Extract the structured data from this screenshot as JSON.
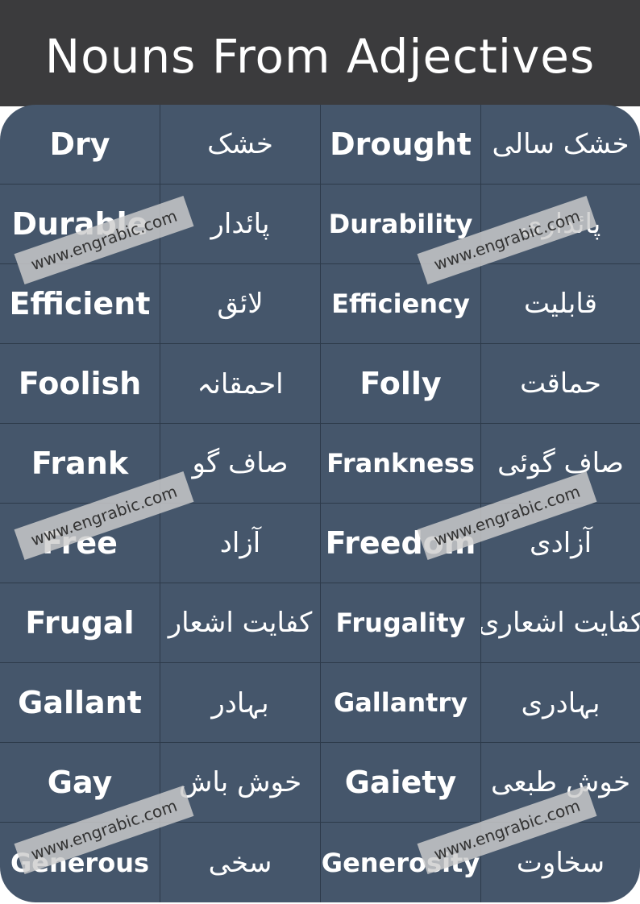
{
  "title": "Nouns From Adjectives",
  "rows": [
    {
      "adj": "Dry",
      "adj_ur": "خشک",
      "noun": "Drought",
      "noun_ur": "خشک سالی"
    },
    {
      "adj": "Durable",
      "adj_ur": "پائدار",
      "noun": "Durability",
      "noun_ur": "پائداری"
    },
    {
      "adj": "Efficient",
      "adj_ur": "لائق",
      "noun": "Efficiency",
      "noun_ur": "قابلیت"
    },
    {
      "adj": "Foolish",
      "adj_ur": "احمقانہ",
      "noun": "Folly",
      "noun_ur": "حماقت"
    },
    {
      "adj": "Frank",
      "adj_ur": "صاف گو",
      "noun": "Frankness",
      "noun_ur": "صاف گوئی"
    },
    {
      "adj": "Free",
      "adj_ur": "آزاد",
      "noun": "Freedom",
      "noun_ur": "آزادی"
    },
    {
      "adj": "Frugal",
      "adj_ur": "کفایت اشعار",
      "noun": "Frugality",
      "noun_ur": "کفایت اشعاری"
    },
    {
      "adj": "Gallant",
      "adj_ur": "بہادر",
      "noun": "Gallantry",
      "noun_ur": "بہادری"
    },
    {
      "adj": "Gay",
      "adj_ur": "خوش باش",
      "noun": "Gaiety",
      "noun_ur": "خوش طبعی"
    },
    {
      "adj": "Generous",
      "adj_ur": "سخی",
      "noun": "Generosity",
      "noun_ur": "سخاوت"
    }
  ],
  "watermark": "www.engrabic.com",
  "colors": {
    "header": "#3b3b3d",
    "board": "#45566b",
    "text": "#ffffff"
  }
}
